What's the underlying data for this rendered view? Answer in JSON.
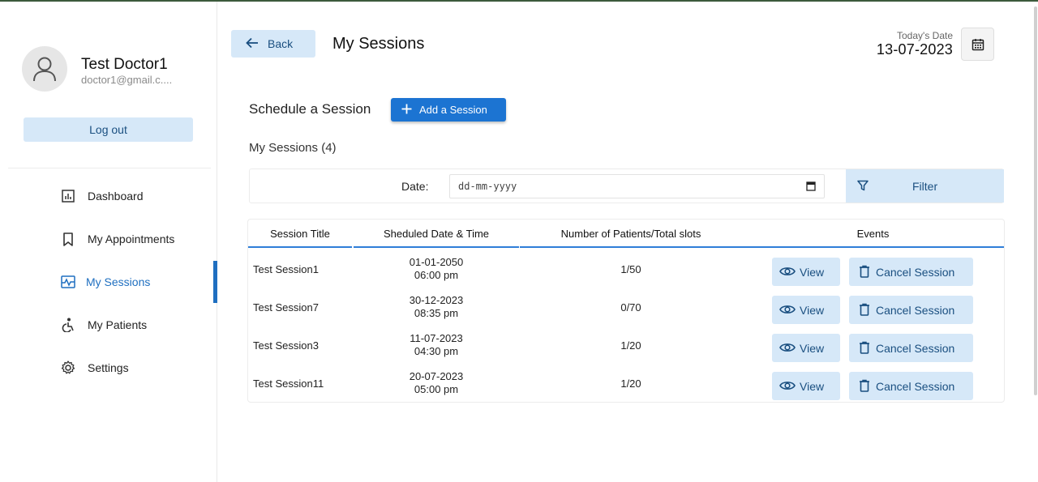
{
  "profile": {
    "name": "Test Doctor1",
    "email": "doctor1@gmail.c....",
    "logout_label": "Log out"
  },
  "sidebar": {
    "items": [
      {
        "label": "Dashboard",
        "icon": "dashboard-icon",
        "active": false
      },
      {
        "label": "My Appointments",
        "icon": "bookmark-icon",
        "active": false
      },
      {
        "label": "My Sessions",
        "icon": "sessions-icon",
        "active": true
      },
      {
        "label": "My Patients",
        "icon": "accessible-icon",
        "active": false
      },
      {
        "label": "Settings",
        "icon": "gear-icon",
        "active": false
      }
    ]
  },
  "header": {
    "back_label": "Back",
    "title": "My Sessions",
    "today_label": "Today's Date",
    "today_value": "13-07-2023"
  },
  "schedule": {
    "label": "Schedule a Session",
    "add_label": "Add a Session"
  },
  "sessions_count_label": "My Sessions (4)",
  "filter": {
    "date_label": "Date:",
    "date_placeholder": "dd-mm-yyyy",
    "filter_label": "Filter"
  },
  "table": {
    "headers": [
      "Session Title",
      "Sheduled Date & Time",
      "Number of Patients/Total slots",
      "Events"
    ],
    "rows": [
      {
        "title": "Test Session1",
        "date": "01-01-2050",
        "time": "06:00 pm",
        "patients": "1/50"
      },
      {
        "title": "Test Session7",
        "date": "30-12-2023",
        "time": "08:35 pm",
        "patients": "0/70"
      },
      {
        "title": "Test Session3",
        "date": "11-07-2023",
        "time": "04:30 pm",
        "patients": "1/20"
      },
      {
        "title": "Test Session11",
        "date": "20-07-2023",
        "time": "05:00 pm",
        "patients": "1/20"
      }
    ],
    "view_label": "View",
    "cancel_label": "Cancel Session"
  },
  "colors": {
    "accent": "#1f6fc0",
    "button_light": "#d6e8f8",
    "primary_button": "#1c74d2"
  }
}
